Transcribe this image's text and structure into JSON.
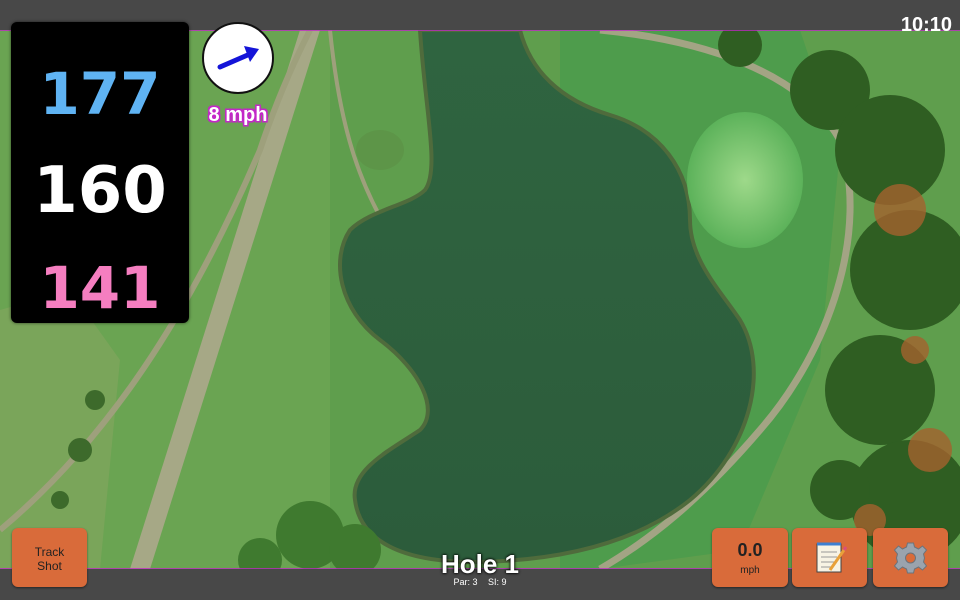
{
  "status_bar": {
    "time": "10:10"
  },
  "distances": {
    "back": "177",
    "middle": "160",
    "front": "141"
  },
  "wind": {
    "speed_label": "8 mph",
    "direction_icon": "arrow-up-right-icon",
    "arrow_color": "#1414d8"
  },
  "hole": {
    "title": "Hole 1",
    "par_label": "Par: 3",
    "si_label": "SI: 9"
  },
  "buttons": {
    "track_shot": {
      "line1": "Track",
      "line2": "Shot"
    },
    "speed": {
      "value": "0.0",
      "unit": "mph"
    },
    "notes": {
      "icon": "notepad-icon"
    },
    "settings": {
      "icon": "gear-icon"
    }
  },
  "colors": {
    "button": "#d96b3a",
    "back_distance": "#5fb3f3",
    "front_distance": "#f57ec0",
    "wind_outline": "#c326c8",
    "map_accent": "#c326c8"
  }
}
